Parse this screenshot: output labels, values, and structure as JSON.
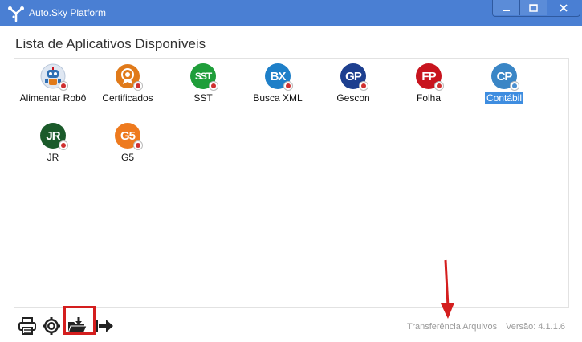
{
  "window": {
    "title": "Auto.Sky Platform"
  },
  "heading": "Lista de Aplicativos Disponíveis",
  "apps": [
    {
      "label": "Alimentar Robô",
      "icon": "robot-icon",
      "abbr": "",
      "color": "#2f6fb3",
      "selected": false
    },
    {
      "label": "Certificados",
      "icon": "certificate-icon",
      "abbr": "",
      "color": "#e07a1a",
      "selected": false
    },
    {
      "label": "SST",
      "icon": "sst-icon",
      "abbr": "SST",
      "color": "#1f9e3a",
      "selected": false
    },
    {
      "label": "Busca XML",
      "icon": "bx-icon",
      "abbr": "BX",
      "color": "#1e7fc8",
      "selected": false
    },
    {
      "label": "Gescon",
      "icon": "gp-icon",
      "abbr": "GP",
      "color": "#1d3f8f",
      "selected": false
    },
    {
      "label": "Folha",
      "icon": "fp-icon",
      "abbr": "FP",
      "color": "#c8141e",
      "selected": false
    },
    {
      "label": "Contábil",
      "icon": "cp-icon",
      "abbr": "CP",
      "color": "#3a86c6",
      "selected": true
    },
    {
      "label": "JR",
      "icon": "jr-icon",
      "abbr": "JR",
      "color": "#1a5a2a",
      "selected": false
    },
    {
      "label": "G5",
      "icon": "g5-icon",
      "abbr": "G5",
      "color": "#ee7a1e",
      "selected": false
    }
  ],
  "toolbar": {
    "print": "printer-icon",
    "settings": "gear-icon",
    "transfer": "folder-download-icon",
    "exit": "exit-arrow-icon"
  },
  "status": {
    "transfer_link": "Transferência Arquivos",
    "version": "Versão: 4.1.1.6"
  },
  "colors": {
    "titlebar": "#4a7fd3",
    "highlight": "#d41e1e",
    "selection": "#3e8de0"
  }
}
